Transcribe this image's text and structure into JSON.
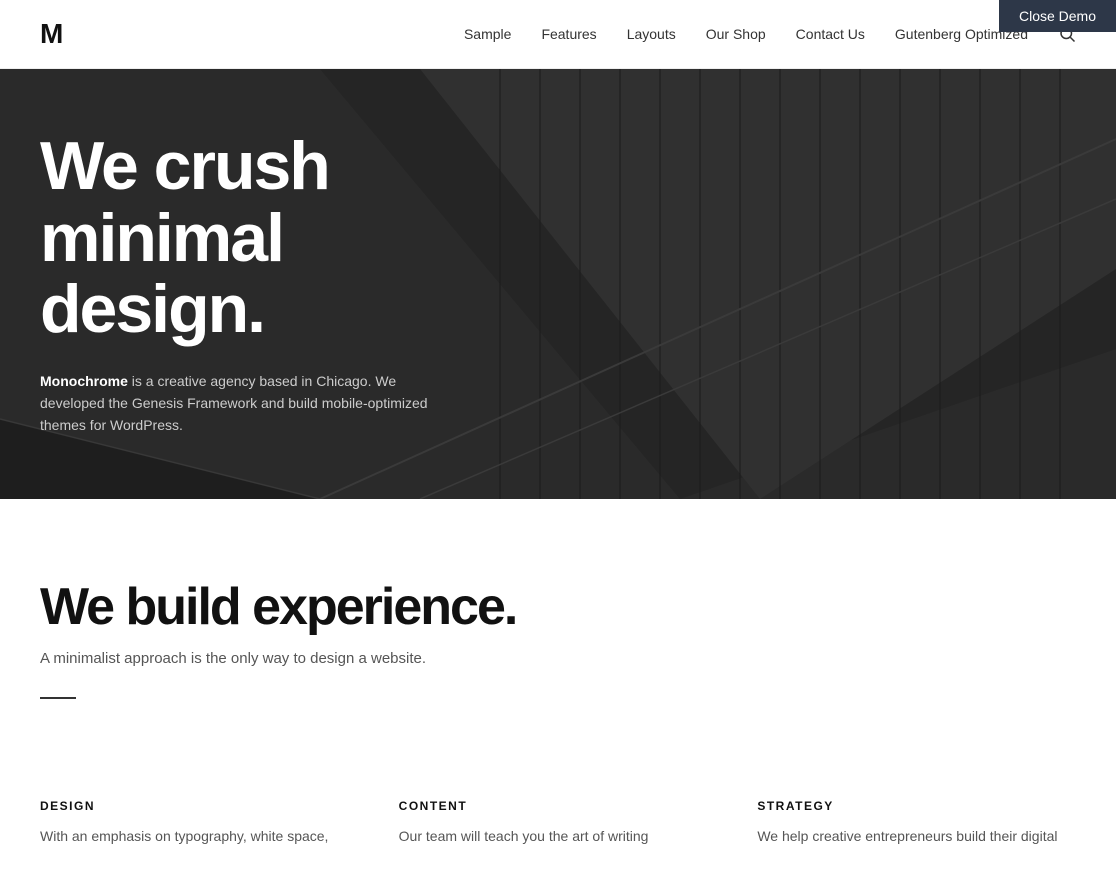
{
  "demo_bar": {
    "label": "Close Demo"
  },
  "header": {
    "logo": "M",
    "nav": [
      {
        "label": "Sample"
      },
      {
        "label": "Features"
      },
      {
        "label": "Layouts"
      },
      {
        "label": "Our Shop"
      },
      {
        "label": "Contact Us"
      },
      {
        "label": "Gutenberg Optimized"
      }
    ]
  },
  "hero": {
    "title_line1": "We crush",
    "title_line2": "minimal",
    "title_line3": "design.",
    "description_bold": "Monochrome",
    "description_rest": " is a creative agency based in Chicago. We developed the Genesis Framework and build mobile-optimized themes for WordPress."
  },
  "main": {
    "heading": "We build experience.",
    "subtext": "A minimalist approach is the only way to design a website."
  },
  "columns": [
    {
      "title": "DESIGN",
      "text": "With an emphasis on typography, white space,"
    },
    {
      "title": "CONTENT",
      "text": "Our team will teach you the art of writing"
    },
    {
      "title": "STRATEGY",
      "text": "We help creative entrepreneurs build their digital"
    }
  ]
}
